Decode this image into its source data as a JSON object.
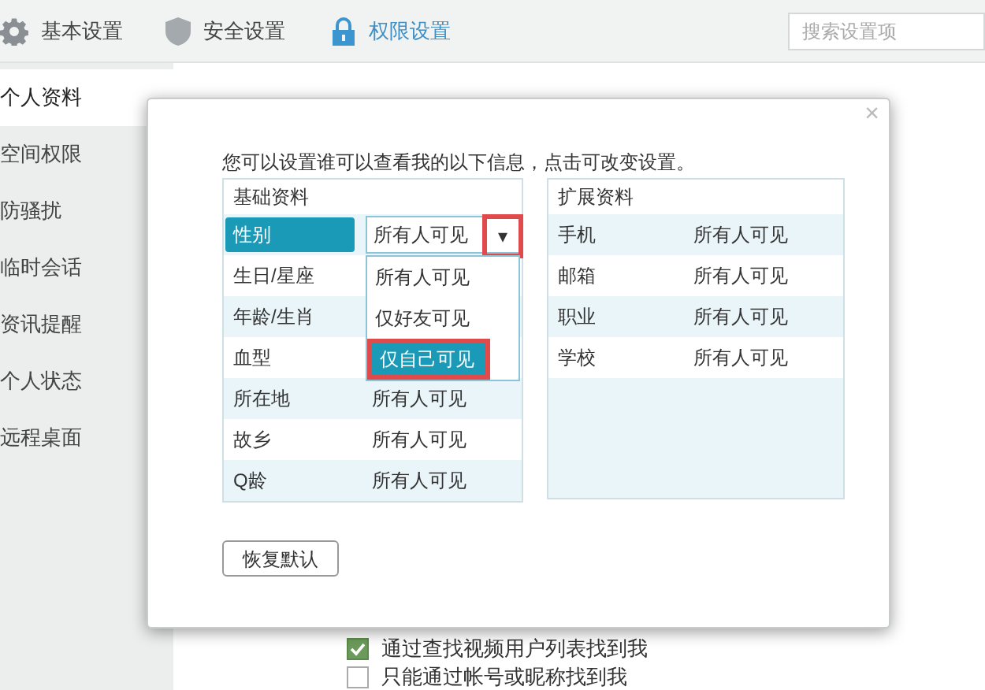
{
  "top_tabs": [
    {
      "label": "基本设置",
      "selected": false
    },
    {
      "label": "安全设置",
      "selected": false
    },
    {
      "label": "权限设置",
      "selected": true
    }
  ],
  "search": {
    "placeholder": "搜索设置项"
  },
  "sidebar": {
    "items": [
      {
        "label": "个人资料",
        "selected": true
      },
      {
        "label": "空间权限",
        "selected": false
      },
      {
        "label": "防骚扰",
        "selected": false
      },
      {
        "label": "临时会话",
        "selected": false
      },
      {
        "label": "资讯提醒",
        "selected": false
      },
      {
        "label": "个人状态",
        "selected": false
      },
      {
        "label": "远程桌面",
        "selected": false
      }
    ]
  },
  "options": [
    {
      "label": "通过查找视频用户列表找到我",
      "checked": true
    },
    {
      "label": "只能通过帐号或昵称找到我",
      "checked": false
    }
  ],
  "dialog": {
    "close": "×",
    "intro": "您可以设置谁可以查看我的以下信息，点击可改变设置。",
    "basic": {
      "title": "基础资料",
      "rows": [
        {
          "label": "性别",
          "value": "所有人可见",
          "kind": "dropdown",
          "selected": true
        },
        {
          "label": "生日/星座",
          "kind": "plain",
          "selected": false
        },
        {
          "label": "年龄/生肖",
          "kind": "plain",
          "selected": false
        },
        {
          "label": "血型",
          "kind": "plain",
          "selected": false
        },
        {
          "label": "所在地",
          "value": "所有人可见",
          "kind": "plain",
          "selected": false
        },
        {
          "label": "故乡",
          "value": "所有人可见",
          "kind": "plain",
          "selected": false
        },
        {
          "label": "Q龄",
          "value": "所有人可见",
          "kind": "plain",
          "selected": false
        }
      ]
    },
    "dropdown": {
      "arrow": "▾",
      "arrow_highlighted": true,
      "options": [
        {
          "label": "所有人可见",
          "selected": false,
          "highlighted": false
        },
        {
          "label": "仅好友可见",
          "selected": false,
          "highlighted": false
        },
        {
          "label": "仅自己可见",
          "selected": true,
          "highlighted": true
        }
      ]
    },
    "extended": {
      "title": "扩展资料",
      "rows": [
        {
          "label": "手机",
          "value": "所有人可见"
        },
        {
          "label": "邮箱",
          "value": "所有人可见"
        },
        {
          "label": "职业",
          "value": "所有人可见"
        },
        {
          "label": "学校",
          "value": "所有人可见"
        }
      ]
    },
    "reset_button": "恢复默认"
  }
}
